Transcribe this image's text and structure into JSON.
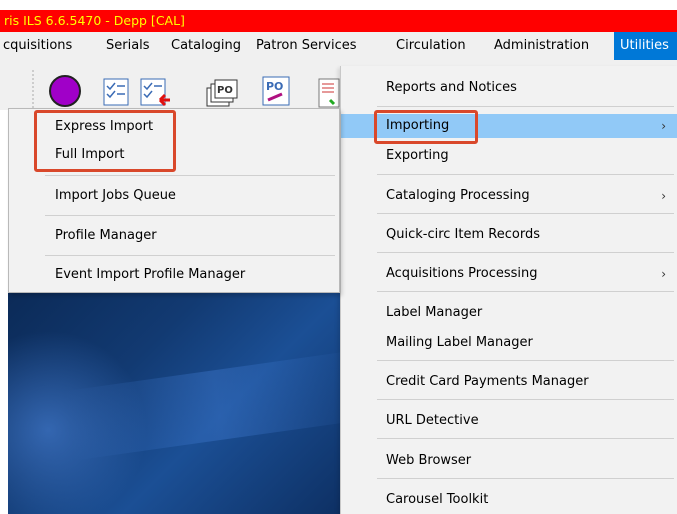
{
  "window": {
    "title": "ris ILS 6.6.5470 - Depp [CAL]"
  },
  "menubar": {
    "items": [
      {
        "label": "cquisitions"
      },
      {
        "label": "Serials"
      },
      {
        "label": "Cataloging"
      },
      {
        "label": "Patron Services"
      },
      {
        "label": "Circulation"
      },
      {
        "label": "Administration"
      },
      {
        "label": "Utilities"
      }
    ],
    "active": "Utilities"
  },
  "toolbar": {
    "icons": [
      "purple-circle-icon",
      "checklist-icon",
      "checklist-arrow-icon",
      "po-stack-icon",
      "po-edit-icon",
      "report-icon"
    ],
    "po_label": "PO"
  },
  "utilities_menu": {
    "items": [
      {
        "label": "Reports and Notices",
        "submenu": false
      },
      {
        "label": "Importing",
        "submenu": true,
        "highlighted": true
      },
      {
        "label": "Exporting",
        "submenu": false
      },
      {
        "label": "Cataloging Processing",
        "submenu": true
      },
      {
        "label": "Quick-circ Item Records",
        "submenu": false
      },
      {
        "label": "Acquisitions Processing",
        "submenu": true
      },
      {
        "label": "Label Manager",
        "submenu": false
      },
      {
        "label": "Mailing Label Manager",
        "submenu": false
      },
      {
        "label": "Credit Card Payments Manager",
        "submenu": false
      },
      {
        "label": "URL Detective",
        "submenu": false
      },
      {
        "label": "Web Browser",
        "submenu": false
      },
      {
        "label": "Carousel Toolkit",
        "submenu": false
      }
    ]
  },
  "importing_submenu": {
    "items": [
      {
        "label": "Express Import"
      },
      {
        "label": "Full Import"
      },
      {
        "label": "Import Jobs Queue"
      },
      {
        "label": "Profile Manager"
      },
      {
        "label": "Event Import Profile Manager"
      }
    ]
  },
  "colors": {
    "titlebar_bg": "#ff0000",
    "titlebar_text": "#ffff00",
    "menu_active": "#0078d7",
    "item_highlight": "#91c9f7",
    "callout_border": "#d9482b"
  }
}
